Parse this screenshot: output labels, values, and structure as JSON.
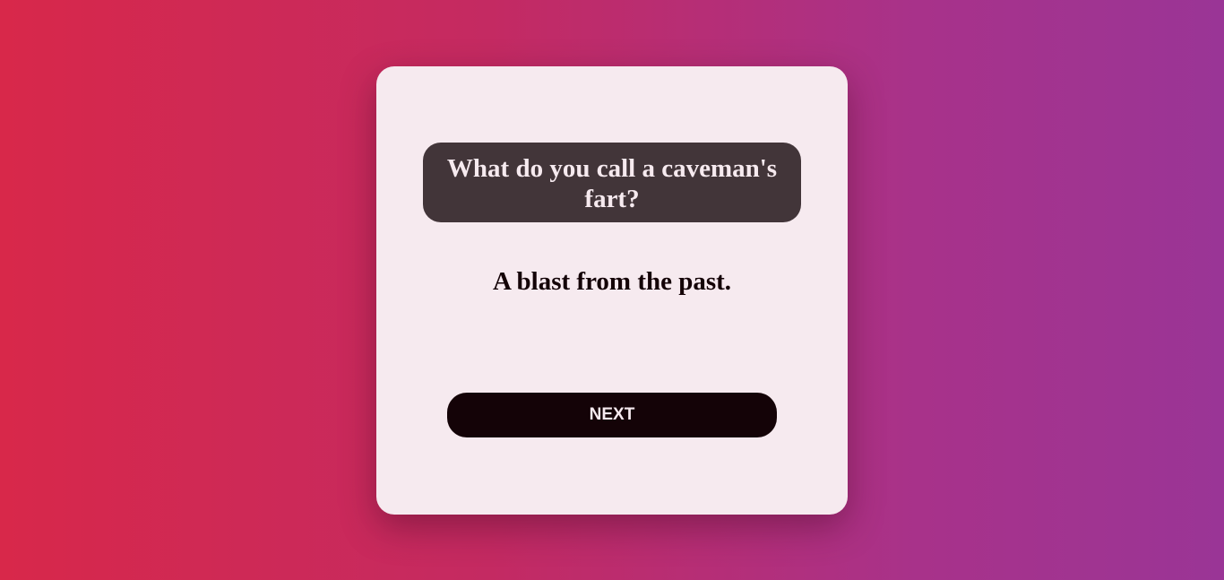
{
  "joke": {
    "question": "What do you call a caveman's fart?",
    "answer": "A blast from the past."
  },
  "controls": {
    "next_label": "NEXT"
  },
  "colors": {
    "background_gradient_start": "#d8284a",
    "background_gradient_end": "#9a3596",
    "card": "#f6eaef",
    "question_box": "#423539",
    "button": "#140307"
  }
}
